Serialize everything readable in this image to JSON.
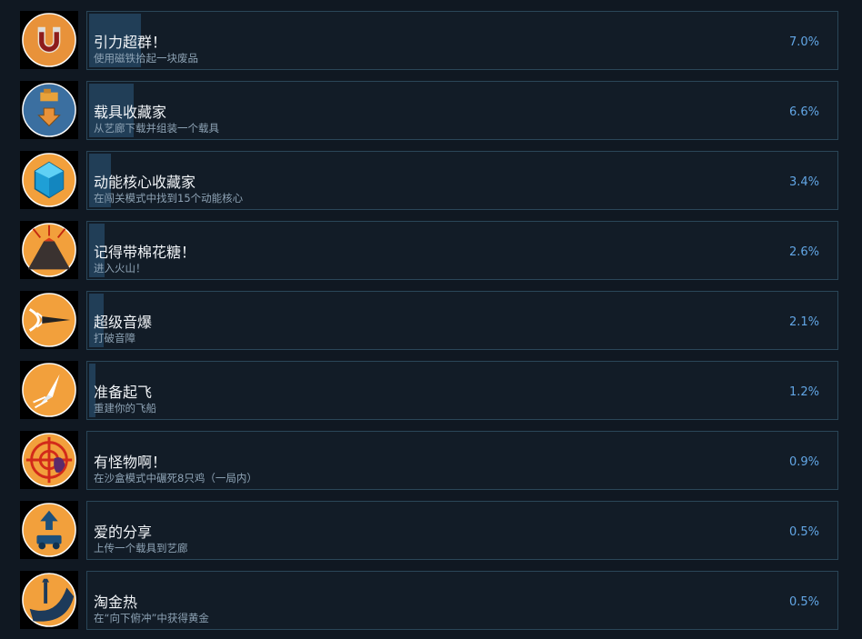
{
  "achievements": [
    {
      "title": "引力超群！",
      "description": "使用磁铁拾起一块废品",
      "percent": "7.0%",
      "percent_value": 7.0,
      "icon": "magnet-icon"
    },
    {
      "title": "载具收藏家",
      "description": "从艺廊下载并组装一个载具",
      "percent": "6.6%",
      "percent_value": 6.6,
      "icon": "download-vehicle-icon"
    },
    {
      "title": "动能核心收藏家",
      "description": "在闯关模式中找到15个动能核心",
      "percent": "3.4%",
      "percent_value": 3.4,
      "icon": "crystal-icon"
    },
    {
      "title": "记得带棉花糖！",
      "description": "进入火山！",
      "percent": "2.6%",
      "percent_value": 2.6,
      "icon": "volcano-icon"
    },
    {
      "title": "超级音爆",
      "description": "打破音障",
      "percent": "2.1%",
      "percent_value": 2.1,
      "icon": "sonic-boom-icon"
    },
    {
      "title": "准备起飞",
      "description": "重建你的飞船",
      "percent": "1.2%",
      "percent_value": 1.2,
      "icon": "spaceship-icon"
    },
    {
      "title": "有怪物啊！",
      "description": "在沙盒模式中碾死8只鸡（一局内）",
      "percent": "0.9%",
      "percent_value": 0.9,
      "icon": "crosshair-monster-icon"
    },
    {
      "title": "爱的分享",
      "description": "上传一个载具到艺廊",
      "percent": "0.5%",
      "percent_value": 0.5,
      "icon": "upload-vehicle-icon"
    },
    {
      "title": "淘金热",
      "description": "在“向下俯冲”中获得黄金",
      "percent": "0.5%",
      "percent_value": 0.5,
      "icon": "gold-pan-icon"
    }
  ],
  "colors": {
    "accent": "#62a6e5",
    "bar": "#213e57",
    "border": "#2a4658",
    "icon_orange": "#f2a03c"
  }
}
